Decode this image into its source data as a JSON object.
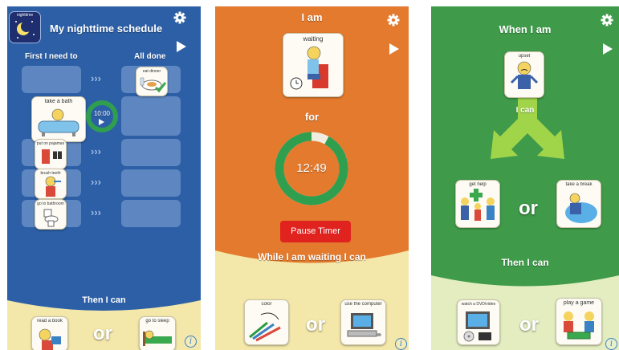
{
  "screen1": {
    "colors": {
      "bg": "#2c5fa6",
      "bottom": "#f3e7a9",
      "slot": "#6f93c9"
    },
    "app_icon_label": "nighttime",
    "title": "My nighttime schedule",
    "first_label": "First I need to",
    "done_label": "All done",
    "done_card": "eat dinner",
    "tasks": [
      "take a bath",
      "put on pajamas",
      "brush teeth",
      "go to bathroom"
    ],
    "timer": "10:00",
    "then_label": "Then I can",
    "rewards": [
      "read a book",
      "go to sleep"
    ],
    "or_label": "or"
  },
  "screen2": {
    "colors": {
      "bg": "#e37a2e",
      "bottom": "#f3e7a9",
      "ring": "#2f9e4f",
      "button": "#e0231f"
    },
    "title": "I am",
    "card": "waiting",
    "for_label": "for",
    "timer": "12:49",
    "timer_remaining_fraction": 0.92,
    "pause_button": "Pause Timer",
    "while_label": "While I am waiting I can",
    "rewards": [
      "color",
      "use the computer"
    ],
    "or_label": "or"
  },
  "screen3": {
    "colors": {
      "bg": "#3f9a4a",
      "bottom": "#e3edc0",
      "arrow": "#a5d84a"
    },
    "title": "When I am",
    "card": "upset",
    "ican_label": "I can",
    "options": [
      "get help",
      "take a break"
    ],
    "then_label": "Then I can",
    "rewards": [
      "watch a DVD/video",
      "play a game"
    ],
    "or_label": "or"
  }
}
